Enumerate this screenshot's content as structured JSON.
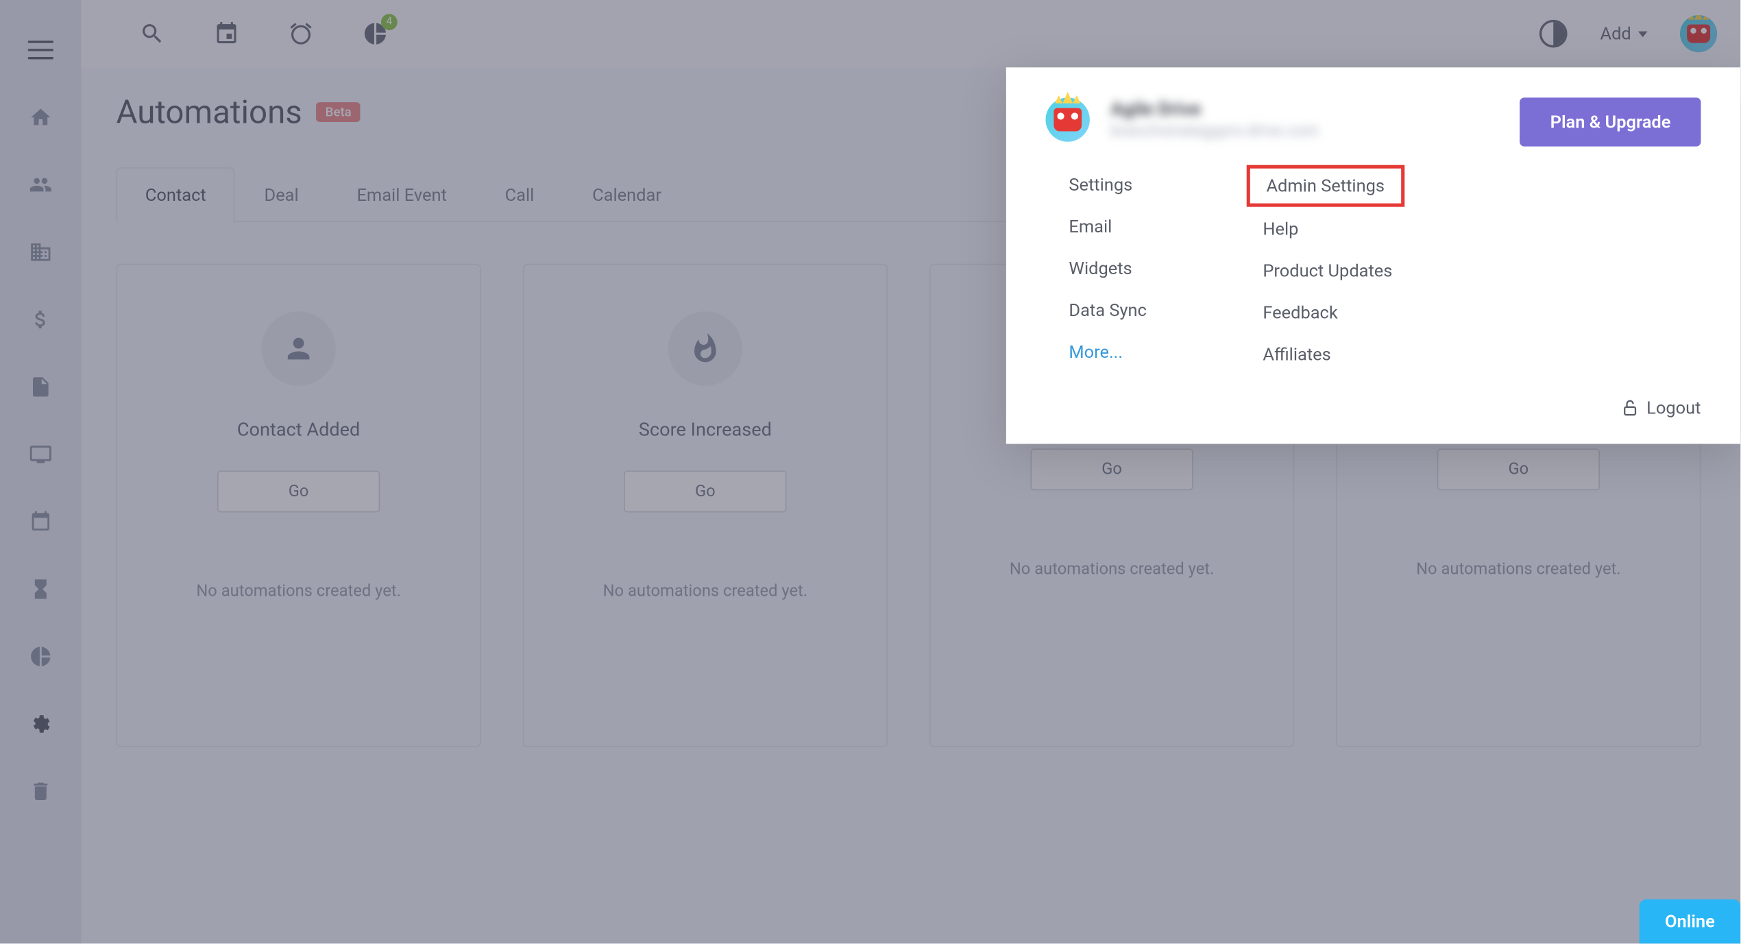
{
  "topbar": {
    "dashboard_badge": "4",
    "add_label": "Add"
  },
  "page": {
    "title": "Automations",
    "badge": "Beta"
  },
  "tabs": [
    {
      "label": "Contact",
      "active": true
    },
    {
      "label": "Deal",
      "active": false
    },
    {
      "label": "Email Event",
      "active": false
    },
    {
      "label": "Call",
      "active": false
    },
    {
      "label": "Calendar",
      "active": false
    }
  ],
  "cards": [
    {
      "title": "Contact Added",
      "go": "Go",
      "empty": "No automations created yet.",
      "icon": "person"
    },
    {
      "title": "Score Increased",
      "go": "Go",
      "empty": "No automations created yet.",
      "icon": "fire"
    },
    {
      "title": "",
      "go": "Go",
      "empty": "No automations created yet.",
      "icon": ""
    },
    {
      "title": "",
      "go": "Go",
      "empty": "No automations created yet.",
      "icon": ""
    }
  ],
  "menu": {
    "plan_btn": "Plan & Upgrade",
    "user_name": "Agile Drive",
    "user_email": "branchstrategypro-drive.com",
    "left": [
      "Settings",
      "Email",
      "Widgets",
      "Data Sync"
    ],
    "more": "More...",
    "right": [
      "Admin Settings",
      "Help",
      "Product Updates",
      "Feedback",
      "Affiliates"
    ],
    "logout": "Logout"
  },
  "online": "Online"
}
